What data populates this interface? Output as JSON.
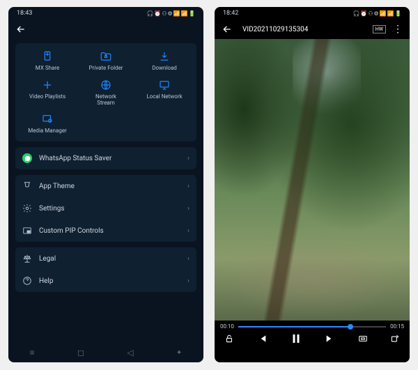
{
  "phone1": {
    "status_time": "18:43",
    "status_icons": "🎧 ⏰ ⚇ ⚙ 📶 📶 🔋",
    "grid": [
      {
        "label": "MX Share"
      },
      {
        "label": "Private Folder"
      },
      {
        "label": "Download"
      },
      {
        "label": "Video Playlists"
      },
      {
        "label": "Network\nStream"
      },
      {
        "label": "Local Network"
      },
      {
        "label": "Media Manager"
      }
    ],
    "rows_a": [
      {
        "label": "WhatsApp Status Saver"
      }
    ],
    "rows_b": [
      {
        "label": "App Theme"
      },
      {
        "label": "Settings"
      },
      {
        "label": "Custom PIP Controls"
      }
    ],
    "rows_c": [
      {
        "label": "Legal"
      },
      {
        "label": "Help"
      }
    ]
  },
  "phone2": {
    "status_time": "18:42",
    "status_icons": "🎧 ⏰ ⚇ ⚙ 📶 📶 🔋",
    "title": "VID20211029135304",
    "hw": "HW",
    "time_cur": "00:10",
    "time_dur": "00:15"
  }
}
